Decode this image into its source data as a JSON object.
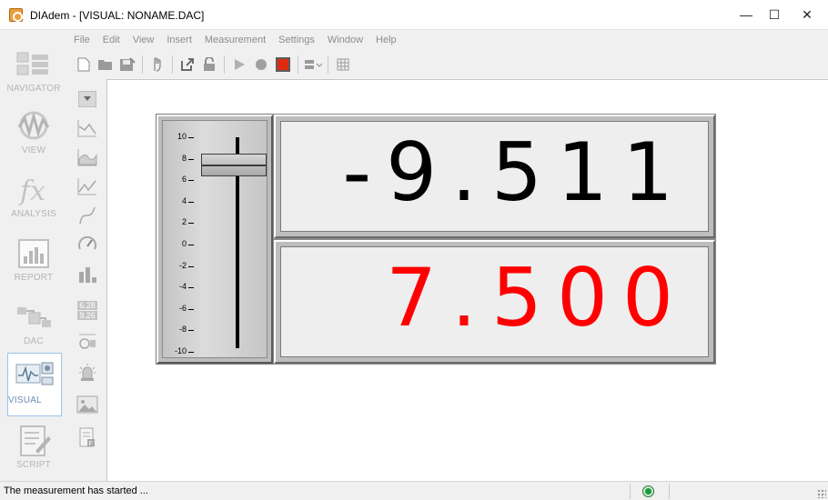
{
  "window": {
    "title": "DIAdem - [VISUAL:  NONAME.DAC]",
    "controls": {
      "minimize": "—",
      "maximize": "☐",
      "close": "✕"
    }
  },
  "menu": [
    "File",
    "Edit",
    "View",
    "Insert",
    "Measurement",
    "Settings",
    "Window",
    "Help"
  ],
  "toolbar": {
    "icons": [
      "new-file-icon",
      "open-folder-icon",
      "save-icon",
      "hand-icon",
      "export-icon",
      "lock-icon",
      "play-icon",
      "record-dot-icon",
      "stop-record-icon",
      "align-icon",
      "grid-icon"
    ],
    "record_color": "#e02a10"
  },
  "navigator": {
    "items": [
      {
        "label": "NAVIGATOR",
        "icon": "navigator-icon"
      },
      {
        "label": "VIEW",
        "icon": "view-icon"
      },
      {
        "label": "ANALYSIS",
        "icon": "analysis-fx-icon"
      },
      {
        "label": "REPORT",
        "icon": "report-icon"
      },
      {
        "label": "DAC",
        "icon": "dac-icon"
      },
      {
        "label": "VISUAL",
        "icon": "visual-icon",
        "active": true
      },
      {
        "label": "SCRIPT",
        "icon": "script-icon"
      }
    ]
  },
  "palette": {
    "icons": [
      "collapse-icon",
      "line-chart-icon",
      "area-chart-icon",
      "xy-chart-icon",
      "curve-icon",
      "gauge-icon",
      "bar-chart-icon",
      "digital-display-icon",
      "slider-control-icon",
      "alarm-icon",
      "image-icon",
      "script-file-icon"
    ],
    "digital_icon_text": [
      "6.28",
      "9.26"
    ]
  },
  "slider": {
    "scale": [
      "10",
      "8",
      "6",
      "4",
      "2",
      "0",
      "-2",
      "-4",
      "-6",
      "-8",
      "-10"
    ],
    "value": 7.5,
    "min": -10,
    "max": 10
  },
  "displays": [
    {
      "value": "-9.511",
      "color": "#000000"
    },
    {
      "value": "7.500",
      "color": "#ff0000"
    }
  ],
  "status": {
    "message": "The measurement has started ...",
    "indicator_color": "#1a9a3a"
  }
}
